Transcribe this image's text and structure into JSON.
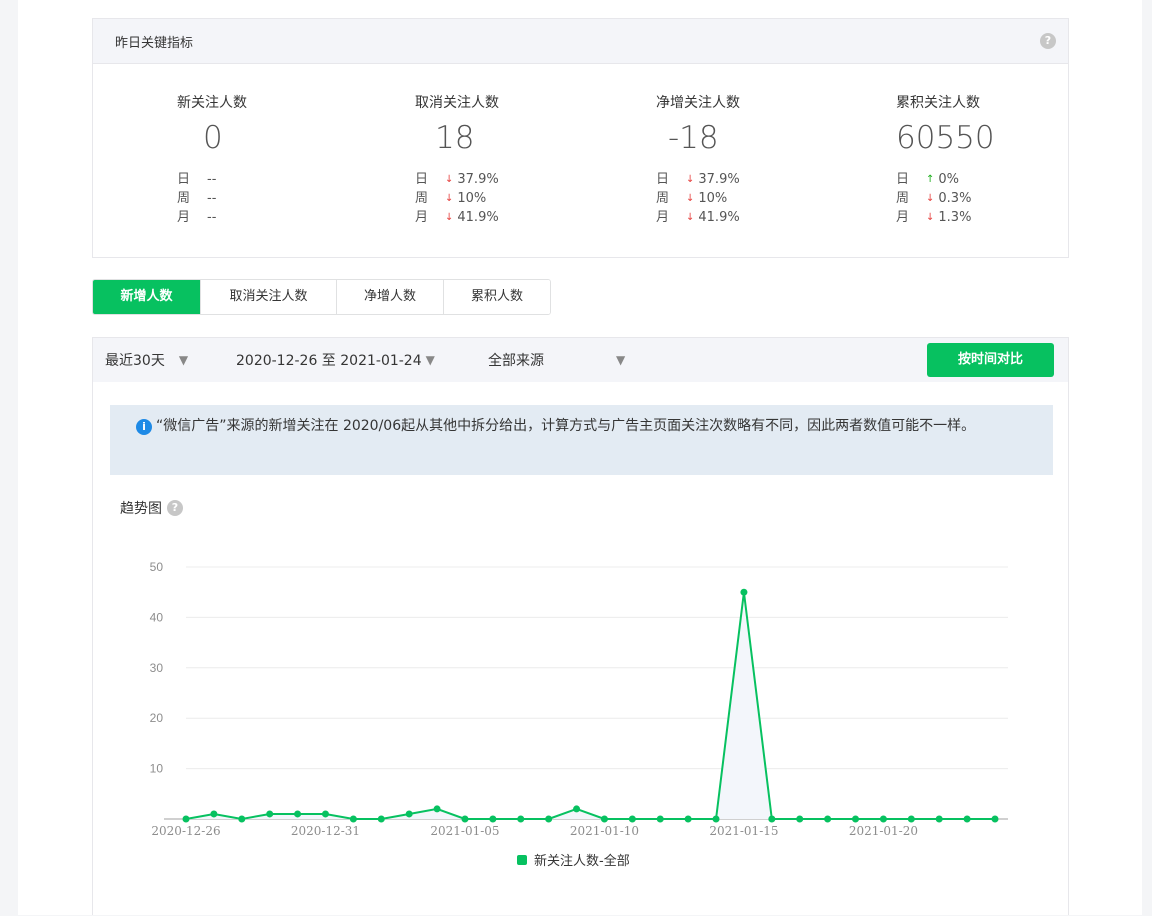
{
  "kpi": {
    "title": "昨日关键指标",
    "help_icon": "question-icon",
    "period_labels": [
      "日",
      "周",
      "月"
    ],
    "metrics": [
      {
        "label": "新关注人数",
        "value": "0",
        "rows": [
          {
            "dir": "none",
            "text": "--"
          },
          {
            "dir": "none",
            "text": "--"
          },
          {
            "dir": "none",
            "text": "--"
          }
        ]
      },
      {
        "label": "取消关注人数",
        "value": "18",
        "rows": [
          {
            "dir": "down",
            "text": "37.9%"
          },
          {
            "dir": "down",
            "text": "10%"
          },
          {
            "dir": "down",
            "text": "41.9%"
          }
        ]
      },
      {
        "label": "净增关注人数",
        "value": "-18",
        "rows": [
          {
            "dir": "down",
            "text": "37.9%"
          },
          {
            "dir": "down",
            "text": "10%"
          },
          {
            "dir": "down",
            "text": "41.9%"
          }
        ]
      },
      {
        "label": "累积关注人数",
        "value": "60550",
        "rows": [
          {
            "dir": "up",
            "text": "0%"
          },
          {
            "dir": "down",
            "text": "0.3%"
          },
          {
            "dir": "down",
            "text": "1.3%"
          }
        ]
      }
    ]
  },
  "tabs": [
    "新增人数",
    "取消关注人数",
    "净增人数",
    "累积人数"
  ],
  "active_tab": 0,
  "filters": {
    "range": "最近30天",
    "dates": "2020-12-26 至 2021-01-24",
    "source": "全部来源",
    "compare_button": "按时间对比"
  },
  "notice": "“微信广告”来源的新增关注在 2020/06起从其他中拆分给出，计算方式与广告主页面关注次数略有不同，因此两者数值可能不一样。",
  "trend_title": "趋势图",
  "colors": {
    "accent": "#07c160",
    "down": "#e64340",
    "up": "#1aad19",
    "info": "#1e8ae6"
  },
  "chart_data": {
    "type": "line",
    "x": [
      "2020-12-26",
      "2020-12-27",
      "2020-12-28",
      "2020-12-29",
      "2020-12-30",
      "2020-12-31",
      "2021-01-01",
      "2021-01-02",
      "2021-01-03",
      "2021-01-04",
      "2021-01-05",
      "2021-01-06",
      "2021-01-07",
      "2021-01-08",
      "2021-01-09",
      "2021-01-10",
      "2021-01-11",
      "2021-01-12",
      "2021-01-13",
      "2021-01-14",
      "2021-01-15",
      "2021-01-16",
      "2021-01-17",
      "2021-01-18",
      "2021-01-19",
      "2021-01-20",
      "2021-01-21",
      "2021-01-22",
      "2021-01-23",
      "2021-01-24"
    ],
    "x_tick_labels": [
      "2020-12-26",
      "2020-12-31",
      "2021-01-05",
      "2021-01-10",
      "2021-01-15",
      "2021-01-20"
    ],
    "series": [
      {
        "name": "新关注人数-全部",
        "values": [
          0,
          1,
          0,
          1,
          1,
          1,
          0,
          0,
          1,
          2,
          0,
          0,
          0,
          0,
          2,
          0,
          0,
          0,
          0,
          0,
          45,
          0,
          0,
          0,
          0,
          0,
          0,
          0,
          0,
          0
        ]
      }
    ],
    "ylim": [
      0,
      50
    ],
    "y_ticks": [
      10,
      20,
      30,
      40,
      50
    ],
    "grid": true,
    "legend": "bottom"
  }
}
